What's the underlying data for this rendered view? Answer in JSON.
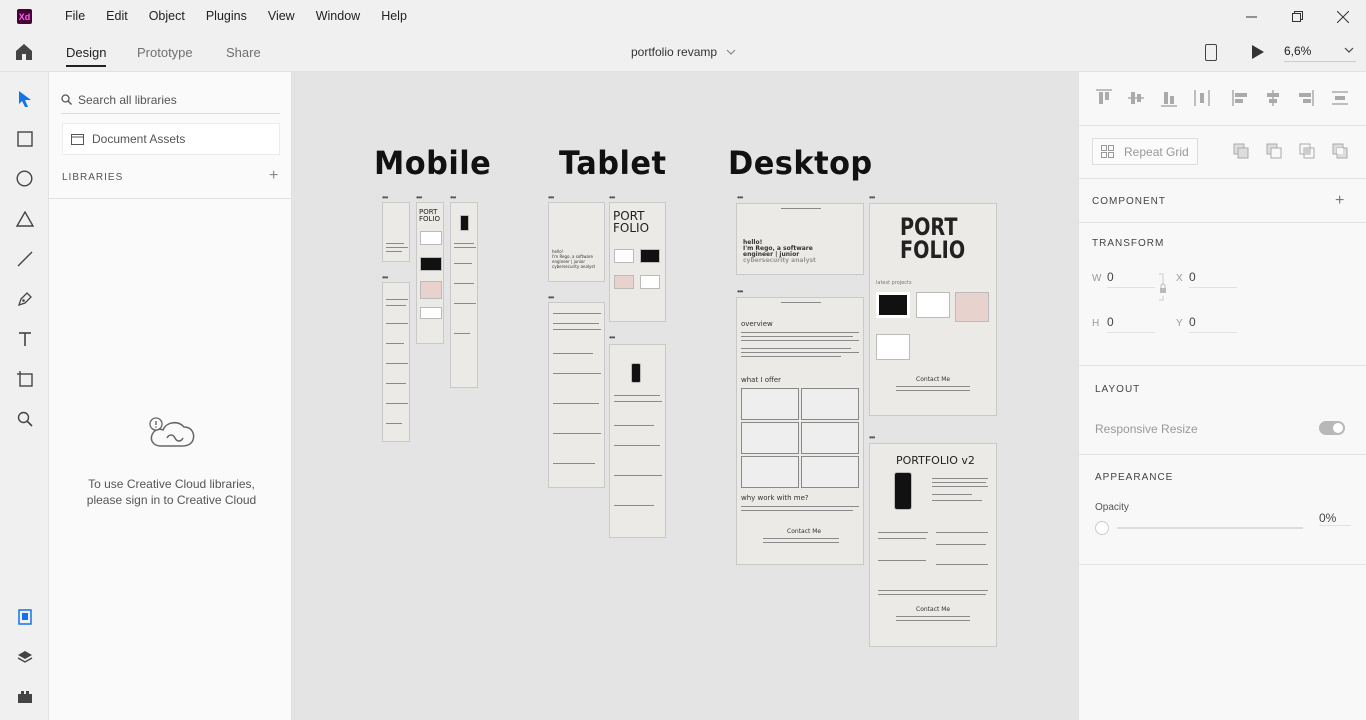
{
  "app": {
    "logo": "Xd",
    "doc_title": "portfolio revamp",
    "zoom": "6,6%"
  },
  "menu": [
    "File",
    "Edit",
    "Object",
    "Plugins",
    "View",
    "Window",
    "Help"
  ],
  "tabs": {
    "design": "Design",
    "prototype": "Prototype",
    "share": "Share"
  },
  "libraries": {
    "search_placeholder": "Search all libraries",
    "document_assets": "Document Assets",
    "header": "LIBRARIES",
    "signin_message": "To use Creative Cloud libraries, please sign in to Creative Cloud"
  },
  "canvas": {
    "sections": [
      "Mobile",
      "Tablet",
      "Desktop"
    ],
    "art": {
      "port": "PORT",
      "folio": "FOLIO",
      "portfolio_v2": "PORTFOLIO v2",
      "hello": "hello!",
      "im_rego": "I'm Rego, a software",
      "engineer": "engineer | junior",
      "cyber": "cybersecurity analyst",
      "overview": "overview",
      "what_i_offer": "what I offer",
      "why_work": "why work with me?",
      "contact_me": "Contact Me",
      "latest_projects": "latest projects"
    }
  },
  "props": {
    "repeat_grid": "Repeat Grid",
    "component": "COMPONENT",
    "transform": "TRANSFORM",
    "w_label": "W",
    "w_val": "0",
    "x_label": "X",
    "x_val": "0",
    "h_label": "H",
    "h_val": "0",
    "y_label": "Y",
    "y_val": "0",
    "layout": "LAYOUT",
    "responsive_resize": "Responsive Resize",
    "appearance": "APPEARANCE",
    "opacity_label": "Opacity",
    "opacity_val": "0%"
  },
  "colors": {
    "accent": "#1473e6",
    "xd_bg": "#470137",
    "xd_fg": "#ff61f6",
    "canvas_bg": "#e4e4e4"
  }
}
